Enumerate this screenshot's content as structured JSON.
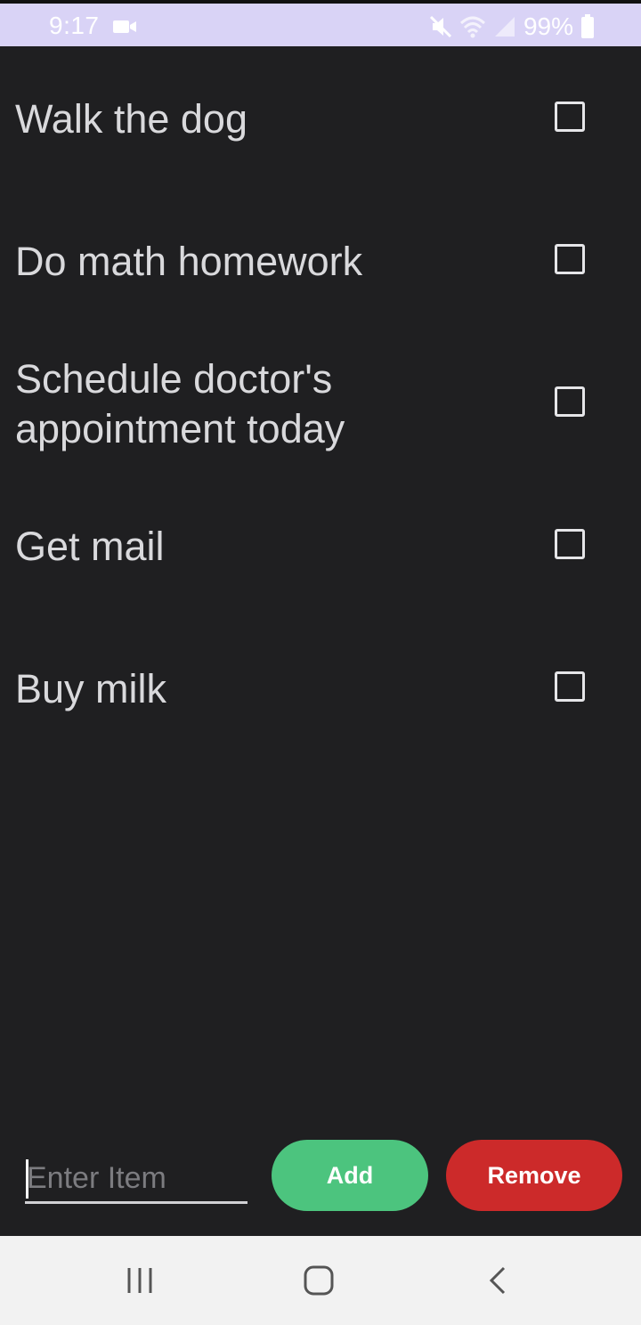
{
  "status_bar": {
    "time": "9:17",
    "battery_percent": "99%",
    "icons": [
      "video-camera-icon",
      "mute-icon",
      "wifi-icon",
      "signal-icon",
      "battery-icon"
    ]
  },
  "todo": {
    "items": [
      {
        "text": "Walk the dog",
        "checked": false
      },
      {
        "text": "Do math homework",
        "checked": false
      },
      {
        "text": "Schedule doctor's appointment today",
        "checked": false
      },
      {
        "text": "Get mail",
        "checked": false
      },
      {
        "text": "Buy milk",
        "checked": false
      }
    ]
  },
  "input": {
    "placeholder": "Enter Item",
    "value": ""
  },
  "buttons": {
    "add_label": "Add",
    "remove_label": "Remove"
  },
  "colors": {
    "background": "#1f1f21",
    "status_bar": "#d9d3f6",
    "add_button": "#4cc47e",
    "remove_button": "#cc2a2a",
    "text": "#d9d9dc"
  },
  "nav_bar": {
    "icons": [
      "recents-icon",
      "home-icon",
      "back-icon"
    ]
  }
}
